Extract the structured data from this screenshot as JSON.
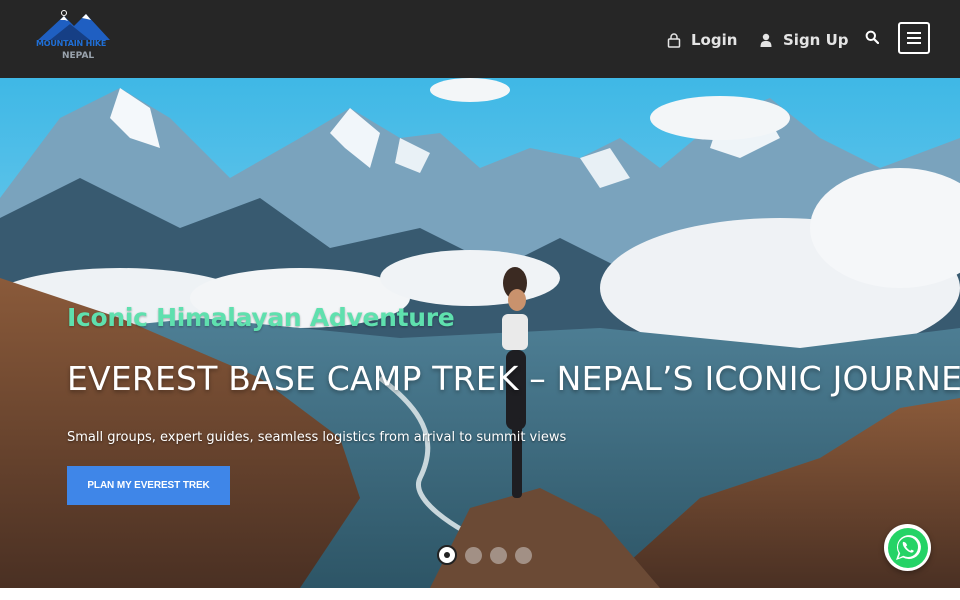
{
  "brand": {
    "logo_line1": "MOUNTAIN HIKE",
    "logo_line2": "NEPAL"
  },
  "header": {
    "login_label": "Login",
    "signup_label": "Sign Up"
  },
  "icons": {
    "login": "lock-icon",
    "signup": "user-icon",
    "search": "search-icon",
    "menu": "hamburger-menu-icon",
    "chat": "whatsapp-icon"
  },
  "hero": {
    "eyebrow": "Iconic Himalayan Adventure",
    "headline": "EVEREST BASE CAMP TREK – NEPAL’S ICONIC JOURNEY",
    "subline": "Small groups, expert guides, seamless logistics from arrival to summit views",
    "cta_label": "PLAN MY EVEREST TREK",
    "slide_count": 4,
    "active_slide": 1
  },
  "colors": {
    "header_bg": "#262626",
    "eyebrow": "#5fe0ae",
    "cta": "#3f86e8",
    "whatsapp": "#25d366"
  }
}
